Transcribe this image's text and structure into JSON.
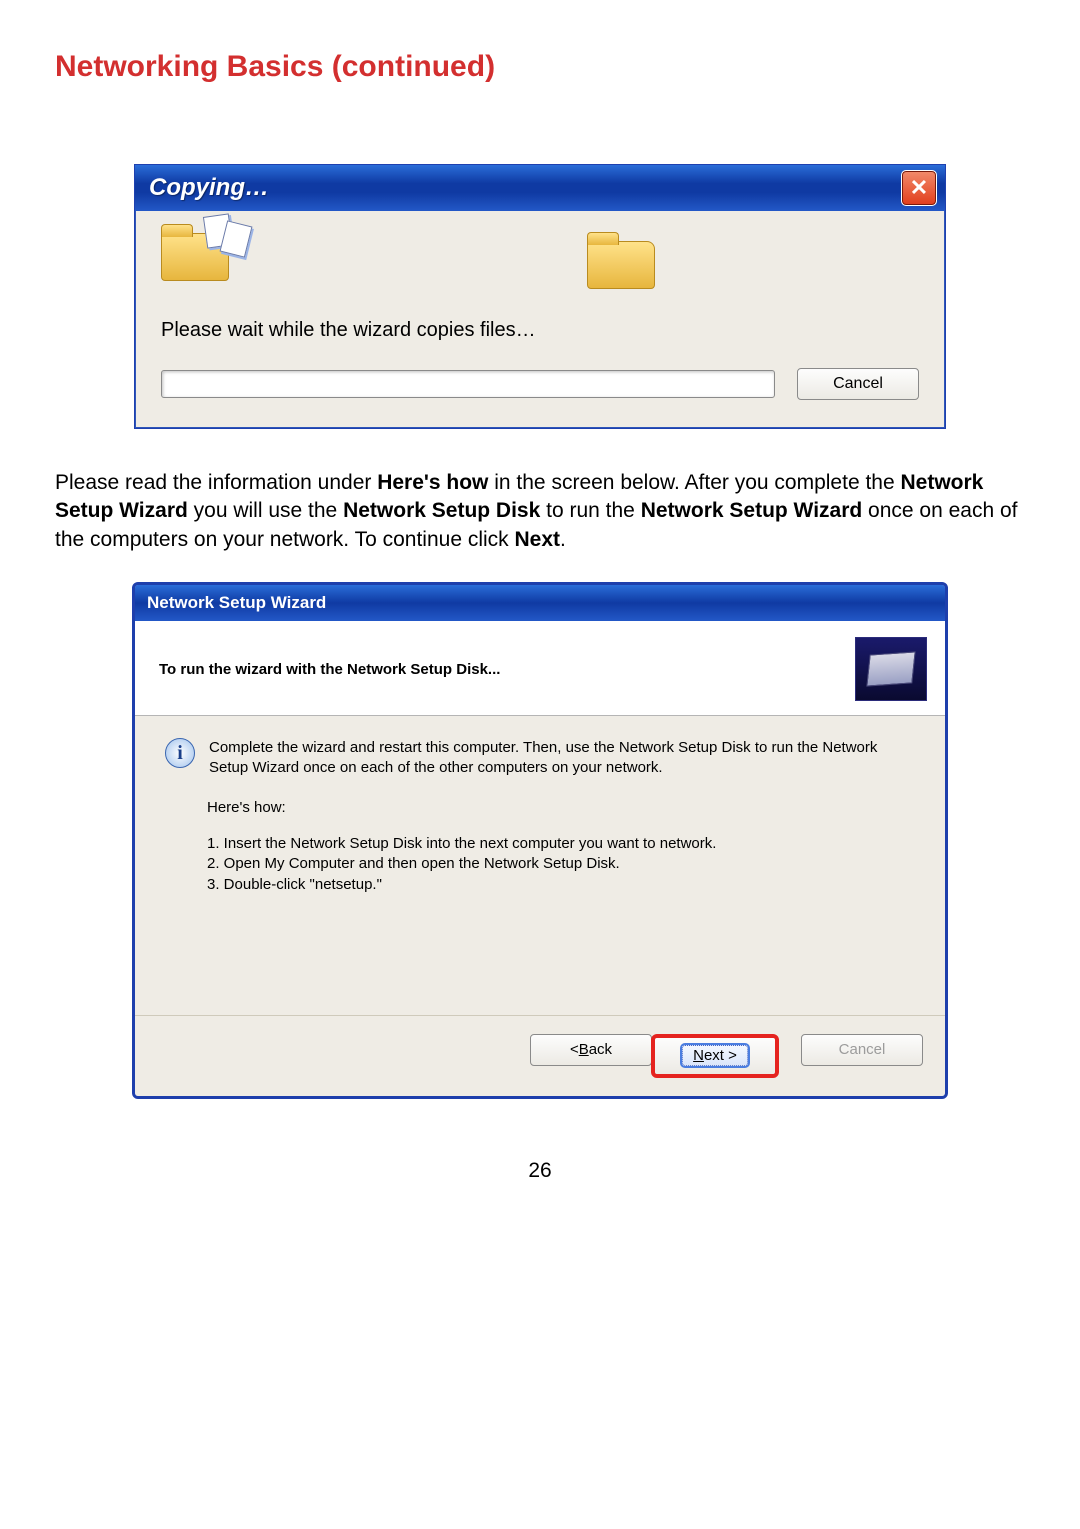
{
  "page": {
    "title": "Networking Basics (continued)",
    "number": "26"
  },
  "dialog1": {
    "title": "Copying…",
    "message": "Please wait while the wizard copies files…",
    "cancel": "Cancel"
  },
  "instruction": {
    "p1a": "Please read the information under ",
    "b1": "Here's how",
    "p1b": " in the screen below. After you complete the ",
    "b2": "Network Setup Wizard",
    "p1c": " you will use the ",
    "b3": "Network Setup Disk",
    "p1d": " to run the ",
    "b4": "Network Setup Wizard",
    "p1e": " once on each of the computers on your network. To continue click ",
    "b5": "Next",
    "p1f": "."
  },
  "dialog2": {
    "title": "Network Setup Wizard",
    "header": "To run the wizard with the Network Setup Disk...",
    "info_text": "Complete the wizard and restart this computer. Then, use the Network Setup Disk to run the Network Setup Wizard once on each of the other computers on your network.",
    "how_label": "Here's how:",
    "step1": "1.  Insert the Network Setup Disk into the next computer you want to network.",
    "step2": "2.  Open My Computer and then open the Network Setup Disk.",
    "step3": "3.  Double-click \"netsetup.\"",
    "back_label_pre": "< ",
    "back_label_u": "B",
    "back_label_post": "ack",
    "next_label_u": "N",
    "next_label_post": "ext >",
    "cancel": "Cancel"
  }
}
